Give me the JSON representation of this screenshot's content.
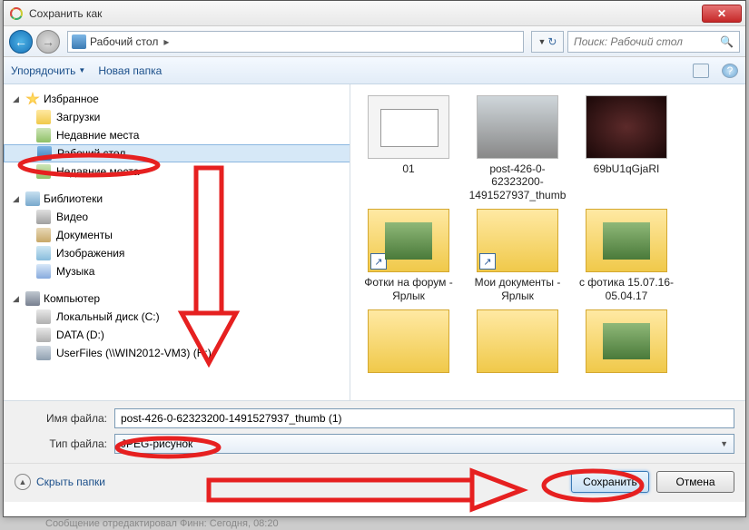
{
  "title": "Сохранить как",
  "breadcrumb": {
    "location": "Рабочий стол"
  },
  "search": {
    "placeholder": "Поиск: Рабочий стол"
  },
  "toolbar": {
    "organize": "Упорядочить",
    "newfolder": "Новая папка"
  },
  "tree": {
    "favorites": {
      "label": "Избранное",
      "items": [
        {
          "label": "Загрузки"
        },
        {
          "label": "Недавние места"
        },
        {
          "label": "Рабочий стол"
        },
        {
          "label": "Недавние места"
        }
      ]
    },
    "libraries": {
      "label": "Библиотеки",
      "items": [
        {
          "label": "Видео"
        },
        {
          "label": "Документы"
        },
        {
          "label": "Изображения"
        },
        {
          "label": "Музыка"
        }
      ]
    },
    "computer": {
      "label": "Компьютер",
      "items": [
        {
          "label": "Локальный диск (C:)"
        },
        {
          "label": "DATA (D:)"
        },
        {
          "label": "UserFiles (\\\\WIN2012-VM3) (H:)"
        }
      ]
    }
  },
  "files": [
    {
      "label": "01",
      "type": "image",
      "variant": "t1"
    },
    {
      "label": "post-426-0-62323200-1491527937_thumb",
      "type": "image",
      "variant": "t2"
    },
    {
      "label": "69bU1qGjaRI",
      "type": "image",
      "variant": "t3"
    },
    {
      "label": "Фотки на форум - Ярлык",
      "type": "folder",
      "shortcut": true
    },
    {
      "label": "Мои документы - Ярлык",
      "type": "folder",
      "shortcut": true
    },
    {
      "label": "с фотика 15.07.16-05.04.17",
      "type": "folder-pic"
    }
  ],
  "fields": {
    "filename_label": "Имя файла:",
    "filename_value": "post-426-0-62323200-1491527937_thumb (1)",
    "filetype_label": "Тип файла:",
    "filetype_value": "JPEG-рисунок"
  },
  "footer": {
    "hide": "Скрыть папки",
    "save": "Сохранить",
    "cancel": "Отмена"
  },
  "status": "Сообщение отредактировал Финн: Сегодня, 08:20"
}
